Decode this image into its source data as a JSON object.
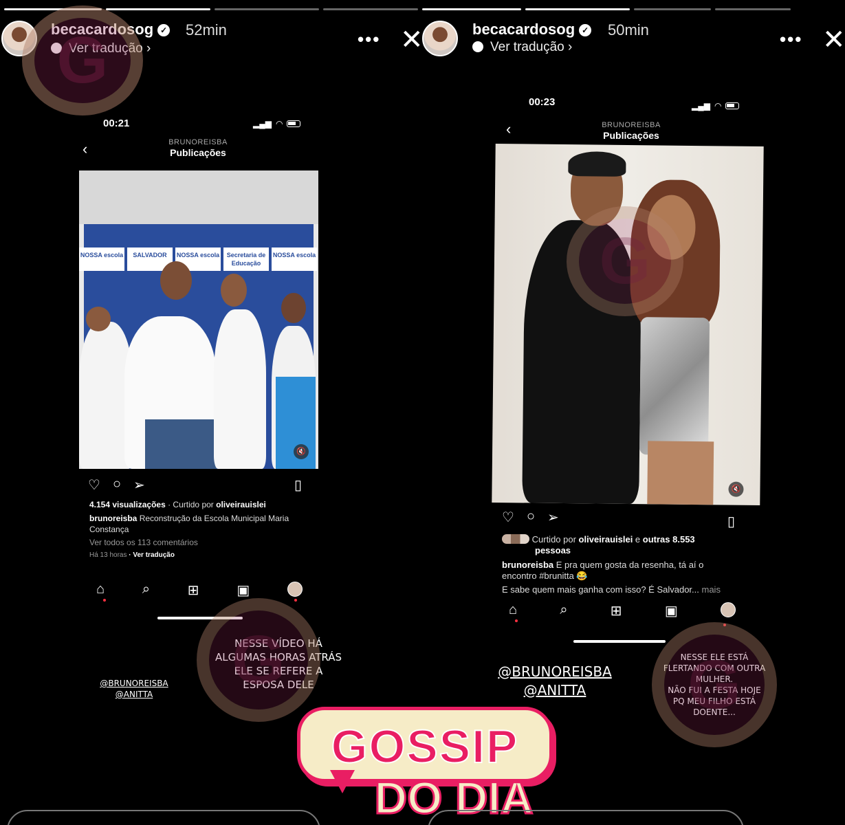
{
  "left_story": {
    "username": "becacardosog",
    "time": "52min",
    "translate": "Ver tradução",
    "more": "•••",
    "close": "✕",
    "phone": {
      "clock": "00:21",
      "account": "BRUNOREISBA",
      "page": "Publicações",
      "banners": [
        "NOSSA escola",
        "SALVADOR",
        "NOSSA escola",
        "Secretaria de Educação",
        "NOSSA escola"
      ],
      "views": "4.154 visualizações",
      "liked_prefix": "· Curtido por ",
      "liked_by": "oliveirauislei",
      "caption_user": "brunoreisba",
      "caption_text": " Reconstrução da Escola Municipal Maria Constança",
      "comments": "Ver todos os 113 comentários",
      "posted": "Há 13 horas",
      "translate": "· Ver tradução"
    },
    "mentions": [
      "@BRUNOREISBA",
      "@ANITTA"
    ],
    "note": [
      "NESSE VÍDEO HÁ",
      "ALGUMAS HORAS ATRÁS",
      "ELE SE REFERE A",
      "ESPOSA DELE"
    ]
  },
  "right_story": {
    "username": "becacardosog",
    "time": "50min",
    "translate": "Ver tradução",
    "more": "•••",
    "close": "✕",
    "phone": {
      "clock": "00:23",
      "account": "BRUNOREISBA",
      "page": "Publicações",
      "liked_prefix": "Curtido por ",
      "liked_by": "oliveirauislei",
      "liked_rest": " e ",
      "liked_others": "outras 8.553",
      "liked_others2": "pessoas",
      "caption_user": "brunoreisba",
      "caption_text": " E pra quem gosta da resenha, tá aí o",
      "caption_line2": "encontro #brunitta 😂",
      "caption_line3": "E sabe quem mais ganha com isso? É Salvador...",
      "caption_more": " mais"
    },
    "mentions": [
      "@BRUNOREISBA",
      "@ANITTA"
    ],
    "note": [
      "NESSE ELE ESTÁ",
      "FLERTANDO COM OUTRA",
      "MULHER.",
      "NÃO FUI A FESTA HOJE",
      "PQ MEU FILHO ESTÁ",
      "DOENTE..."
    ]
  },
  "logo": {
    "line1": "GOSSIP",
    "line2": "DO DIA"
  },
  "watermark": "G",
  "colors": {
    "brand_pink": "#e91e63",
    "brand_cream": "#f6ecc7",
    "bg": "#000000"
  }
}
